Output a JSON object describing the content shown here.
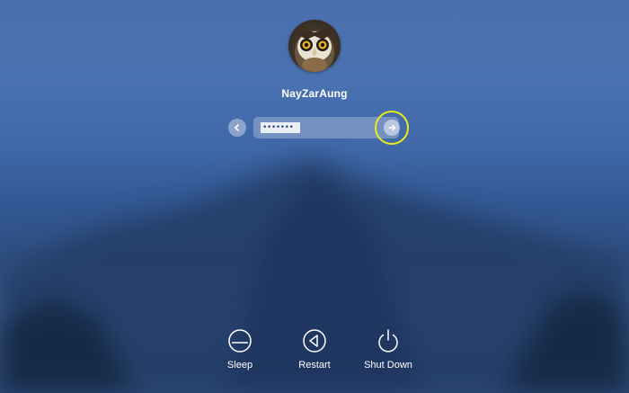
{
  "user": {
    "name": "NayZarAung",
    "avatar_icon": "owl-avatar"
  },
  "login": {
    "password_masked": "•••••••",
    "back_icon": "chevron-left-icon",
    "submit_icon": "arrow-right-icon",
    "highlight_color": "#e8ec1a"
  },
  "power": {
    "sleep_label": "Sleep",
    "restart_label": "Restart",
    "shutdown_label": "Shut Down"
  }
}
